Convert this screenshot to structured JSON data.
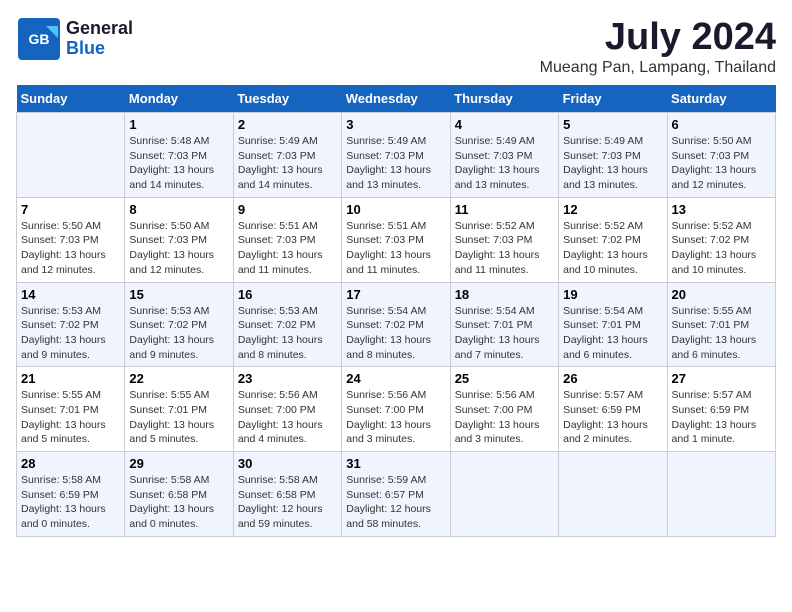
{
  "header": {
    "logo_line1": "General",
    "logo_line2": "Blue",
    "main_title": "July 2024",
    "subtitle": "Mueang Pan, Lampang, Thailand"
  },
  "days_of_week": [
    "Sunday",
    "Monday",
    "Tuesday",
    "Wednesday",
    "Thursday",
    "Friday",
    "Saturday"
  ],
  "weeks": [
    [
      {
        "day": "",
        "info": ""
      },
      {
        "day": "1",
        "info": "Sunrise: 5:48 AM\nSunset: 7:03 PM\nDaylight: 13 hours\nand 14 minutes."
      },
      {
        "day": "2",
        "info": "Sunrise: 5:49 AM\nSunset: 7:03 PM\nDaylight: 13 hours\nand 14 minutes."
      },
      {
        "day": "3",
        "info": "Sunrise: 5:49 AM\nSunset: 7:03 PM\nDaylight: 13 hours\nand 13 minutes."
      },
      {
        "day": "4",
        "info": "Sunrise: 5:49 AM\nSunset: 7:03 PM\nDaylight: 13 hours\nand 13 minutes."
      },
      {
        "day": "5",
        "info": "Sunrise: 5:49 AM\nSunset: 7:03 PM\nDaylight: 13 hours\nand 13 minutes."
      },
      {
        "day": "6",
        "info": "Sunrise: 5:50 AM\nSunset: 7:03 PM\nDaylight: 13 hours\nand 12 minutes."
      }
    ],
    [
      {
        "day": "7",
        "info": "Sunrise: 5:50 AM\nSunset: 7:03 PM\nDaylight: 13 hours\nand 12 minutes."
      },
      {
        "day": "8",
        "info": "Sunrise: 5:50 AM\nSunset: 7:03 PM\nDaylight: 13 hours\nand 12 minutes."
      },
      {
        "day": "9",
        "info": "Sunrise: 5:51 AM\nSunset: 7:03 PM\nDaylight: 13 hours\nand 11 minutes."
      },
      {
        "day": "10",
        "info": "Sunrise: 5:51 AM\nSunset: 7:03 PM\nDaylight: 13 hours\nand 11 minutes."
      },
      {
        "day": "11",
        "info": "Sunrise: 5:52 AM\nSunset: 7:03 PM\nDaylight: 13 hours\nand 11 minutes."
      },
      {
        "day": "12",
        "info": "Sunrise: 5:52 AM\nSunset: 7:02 PM\nDaylight: 13 hours\nand 10 minutes."
      },
      {
        "day": "13",
        "info": "Sunrise: 5:52 AM\nSunset: 7:02 PM\nDaylight: 13 hours\nand 10 minutes."
      }
    ],
    [
      {
        "day": "14",
        "info": "Sunrise: 5:53 AM\nSunset: 7:02 PM\nDaylight: 13 hours\nand 9 minutes."
      },
      {
        "day": "15",
        "info": "Sunrise: 5:53 AM\nSunset: 7:02 PM\nDaylight: 13 hours\nand 9 minutes."
      },
      {
        "day": "16",
        "info": "Sunrise: 5:53 AM\nSunset: 7:02 PM\nDaylight: 13 hours\nand 8 minutes."
      },
      {
        "day": "17",
        "info": "Sunrise: 5:54 AM\nSunset: 7:02 PM\nDaylight: 13 hours\nand 8 minutes."
      },
      {
        "day": "18",
        "info": "Sunrise: 5:54 AM\nSunset: 7:01 PM\nDaylight: 13 hours\nand 7 minutes."
      },
      {
        "day": "19",
        "info": "Sunrise: 5:54 AM\nSunset: 7:01 PM\nDaylight: 13 hours\nand 6 minutes."
      },
      {
        "day": "20",
        "info": "Sunrise: 5:55 AM\nSunset: 7:01 PM\nDaylight: 13 hours\nand 6 minutes."
      }
    ],
    [
      {
        "day": "21",
        "info": "Sunrise: 5:55 AM\nSunset: 7:01 PM\nDaylight: 13 hours\nand 5 minutes."
      },
      {
        "day": "22",
        "info": "Sunrise: 5:55 AM\nSunset: 7:01 PM\nDaylight: 13 hours\nand 5 minutes."
      },
      {
        "day": "23",
        "info": "Sunrise: 5:56 AM\nSunset: 7:00 PM\nDaylight: 13 hours\nand 4 minutes."
      },
      {
        "day": "24",
        "info": "Sunrise: 5:56 AM\nSunset: 7:00 PM\nDaylight: 13 hours\nand 3 minutes."
      },
      {
        "day": "25",
        "info": "Sunrise: 5:56 AM\nSunset: 7:00 PM\nDaylight: 13 hours\nand 3 minutes."
      },
      {
        "day": "26",
        "info": "Sunrise: 5:57 AM\nSunset: 6:59 PM\nDaylight: 13 hours\nand 2 minutes."
      },
      {
        "day": "27",
        "info": "Sunrise: 5:57 AM\nSunset: 6:59 PM\nDaylight: 13 hours\nand 1 minute."
      }
    ],
    [
      {
        "day": "28",
        "info": "Sunrise: 5:58 AM\nSunset: 6:59 PM\nDaylight: 13 hours\nand 0 minutes."
      },
      {
        "day": "29",
        "info": "Sunrise: 5:58 AM\nSunset: 6:58 PM\nDaylight: 13 hours\nand 0 minutes."
      },
      {
        "day": "30",
        "info": "Sunrise: 5:58 AM\nSunset: 6:58 PM\nDaylight: 12 hours\nand 59 minutes."
      },
      {
        "day": "31",
        "info": "Sunrise: 5:59 AM\nSunset: 6:57 PM\nDaylight: 12 hours\nand 58 minutes."
      },
      {
        "day": "",
        "info": ""
      },
      {
        "day": "",
        "info": ""
      },
      {
        "day": "",
        "info": ""
      }
    ]
  ]
}
